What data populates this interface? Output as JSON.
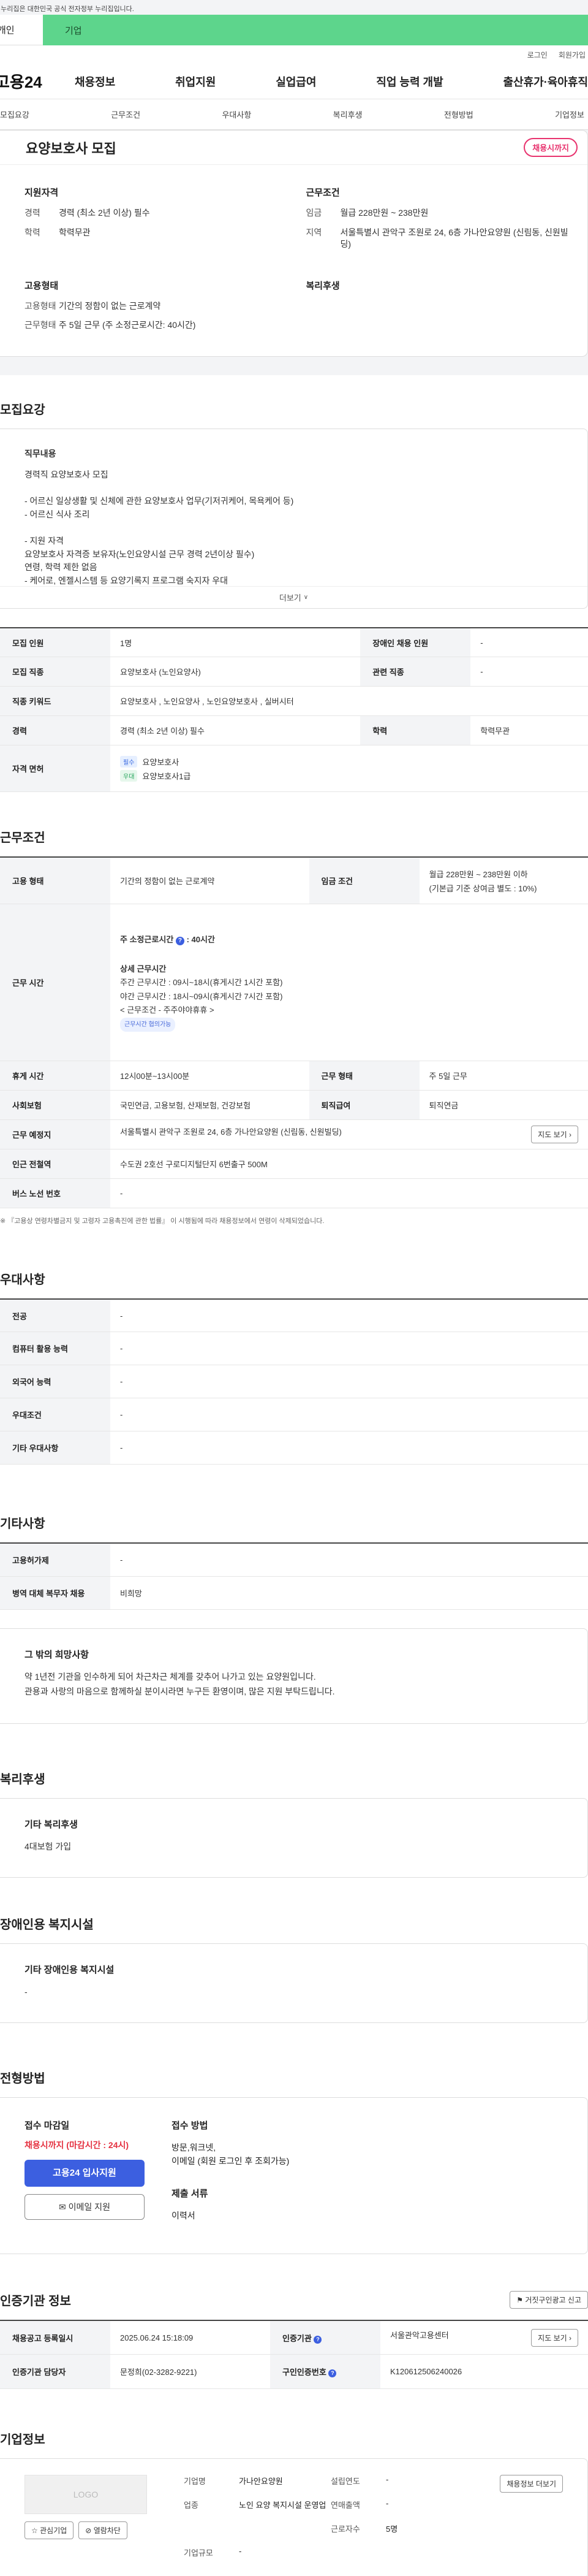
{
  "gov_notice": "이 누리집은 대한민국 공식 전자정부 누리집입니다.",
  "top_tabs": {
    "personal": "개인",
    "company": "기업"
  },
  "util_links": {
    "login": "로그인",
    "signup": "회원가입"
  },
  "logo": "고용24",
  "gnb": [
    "채용정보",
    "취업지원",
    "실업급여",
    "직업 능력 개발",
    "출산휴가·육아휴직"
  ],
  "subnav": [
    "모집요강",
    "근무조건",
    "우대사항",
    "복리후생",
    "전형방법",
    "기업정보"
  ],
  "summary": {
    "title": "요양보호사 모집",
    "badge": "채용시까지",
    "qual_title": "지원자격",
    "qual_rows": [
      {
        "k": "경력",
        "v": "경력 (최소 2년 이상) 필수"
      },
      {
        "k": "학력",
        "v": "학력무관"
      }
    ],
    "cond_title": "근무조건",
    "cond_rows": [
      {
        "k": "임금",
        "v": "월급 228만원 ~ 238만원"
      },
      {
        "k": "지역",
        "v": "서울특별시 관악구 조원로 24, 6층 가나안요양원 (신림동, 신원빌딩)"
      }
    ],
    "emp_title": "고용형태",
    "emp_rows": [
      {
        "k": "고용형태",
        "v": "기간의 정함이 없는 근로계약"
      },
      {
        "k": "근무형태",
        "v": "주 5일 근무 (주 소정근로시간: 40시간)"
      }
    ],
    "welfare_title": "복리후생"
  },
  "recruit": {
    "heading": "모집요강",
    "desc_title": "직무내용",
    "desc_lines": [
      "경력직 요양보호사 모집",
      "",
      "- 어르신 일상생활 및 신체에 관한  요양보호사 업무(기저귀케어, 목욕케어 등)",
      "- 어르신 식사 조리",
      "",
      "- 지원 자격",
      "  요양보호사 자격증 보유자(노인요양시설 근무 경력 2년이상 필수)",
      "  연령, 학력 제한 없음",
      "- 케어로, 엔젤시스템 등 요양기록지 프로그램 숙지자 우대"
    ],
    "more": "더보기",
    "table": {
      "count_l": "모집 인원",
      "count_v": "1명",
      "disabled_l": "장애인 채용 인원",
      "disabled_v": "-",
      "job_l": "모집 직종",
      "job_v": "요양보호사 (노인요양사)",
      "rel_l": "관련 직종",
      "rel_v": "-",
      "kw_l": "직종 키워드",
      "kw_v": "요양보호사 , 노인요양사 , 노인요양보호사 , 실버시터",
      "exp_l": "경력",
      "exp_v": "경력 (최소 2년 이상) 필수",
      "edu_l": "학력",
      "edu_v": "학력무관",
      "lic_l": "자격 면허",
      "lic": [
        {
          "tag": "필수",
          "name": "요양보호사"
        },
        {
          "tag": "우대",
          "name": "요양보호사1급"
        }
      ]
    }
  },
  "work": {
    "heading": "근무조건",
    "emp_l": "고용 형태",
    "emp_v": "기간의 정함이 없는 근로계약",
    "wage_l": "임금 조건",
    "wage_v1": "월급 228만원 ~ 238만원 이하",
    "wage_v2": "(기본급 기준 상여금 별도 : 10%)",
    "time_l": "근무 시간",
    "time_week": "주 소정근로시간",
    "time_week_v": ": 40시간",
    "time_detail_title": "상세 근무시간",
    "time_lines": [
      "주간 근무시간 : 09시~18시(휴게시간 1시간 포함)",
      "야간 근무시간 : 18시~09시(휴게시간 7시간 포함)",
      "< 근무조건  - 주주야야휴휴 >"
    ],
    "time_pill": "근무시간 협의가능",
    "rest_l": "휴게 시간",
    "rest_v": "12시00분~13시00분",
    "form_l": "근무 형태",
    "form_v": "주 5일 근무",
    "ins_l": "사회보험",
    "ins_v": "국민연금, 고용보험, 산재보험, 건강보험",
    "ret_l": "퇴직급여",
    "ret_v": "퇴직연금",
    "place_l": "근무 예정지",
    "place_v": "서울특별시 관악구 조원로 24, 6층 가나안요양원 (신림동, 신원빌딩)",
    "map_btn": "지도 보기",
    "station_l": "인근 전철역",
    "station_v": "수도권 2호선 구로디지털단지 6번출구 500M",
    "bus_l": "버스 노선 번호",
    "bus_v": "-",
    "note": "※ 『고용상 연령차별금지 및 고령자 고용촉진에 관한 법률』 이 시행됨에 따라 채용정보에서 연령이 삭제되었습니다."
  },
  "pref": {
    "heading": "우대사항",
    "rows": [
      {
        "k": "전공",
        "v": "-"
      },
      {
        "k": "컴퓨터 활용 능력",
        "v": "-"
      },
      {
        "k": "외국어 능력",
        "v": "-"
      },
      {
        "k": "우대조건",
        "v": "-"
      },
      {
        "k": "기타 우대사항",
        "v": "-"
      }
    ]
  },
  "etc": {
    "heading": "기타사항",
    "rows": [
      {
        "k": "고용허가제",
        "v": "-"
      },
      {
        "k": "병역 대체 복무자 채용",
        "v": "비희망"
      }
    ],
    "wish_title": "그 밖의 희망사항",
    "wish_lines": [
      "약 1년전 기관을 인수하게 되어 차근차근 체계를 갖추어 나가고 있는 요양원입니다.",
      "관용과 사랑의 마음으로 함께하실 분이시라면 누구든 환영이며, 많은 지원 부탁드립니다."
    ]
  },
  "welfare": {
    "heading": "복리후생",
    "title": "기타 복리후생",
    "value": "4대보험 가입"
  },
  "facility": {
    "heading": "장애인용 복지시설",
    "title": "기타 장애인용 복지시설",
    "value": "-"
  },
  "process": {
    "heading": "전형방법",
    "deadline_title": "접수 마감일",
    "deadline": "채용시까지 (마감시간 : 24시)",
    "apply_btn": "고용24 입사지원",
    "email_btn": "이메일 지원",
    "method_title": "접수 방법",
    "method_lines": [
      "방문,워크넷,",
      "이메일 (회원 로그인 후 조회가능)"
    ],
    "docs_title": "제출 서류",
    "docs": "이력서"
  },
  "auth": {
    "heading": "인증기관 정보",
    "report_btn": "거짓구인광고 신고",
    "reg_l": "채용공고 등록일시",
    "reg_v": "2025.06.24 15:18:09",
    "org_l": "인증기관",
    "org_v": "서울관악고용센터",
    "map_btn": "지도 보기",
    "mgr_l": "인증기관 담당자",
    "mgr_v": "문정희(02-3282-9221)",
    "id_l": "구인인증번호",
    "id_v": "K120612506240026"
  },
  "company": {
    "heading": "기업정보",
    "logo_text": "LOGO",
    "fav_btn": "관심기업",
    "block_btn": "열람차단",
    "more_btn": "채용정보 더보기",
    "rows": [
      {
        "k": "기업명",
        "v": "가나안요양원"
      },
      {
        "k": "설립연도",
        "v": "-"
      },
      {
        "k": "업종",
        "v": "노인 요양 복지시설 운영업"
      },
      {
        "k": "연매출액",
        "v": "-"
      },
      {
        "k": "",
        "v": ""
      },
      {
        "k": "근로자수",
        "v": "5명"
      },
      {
        "k": "기업규모",
        "v": "-"
      }
    ]
  }
}
